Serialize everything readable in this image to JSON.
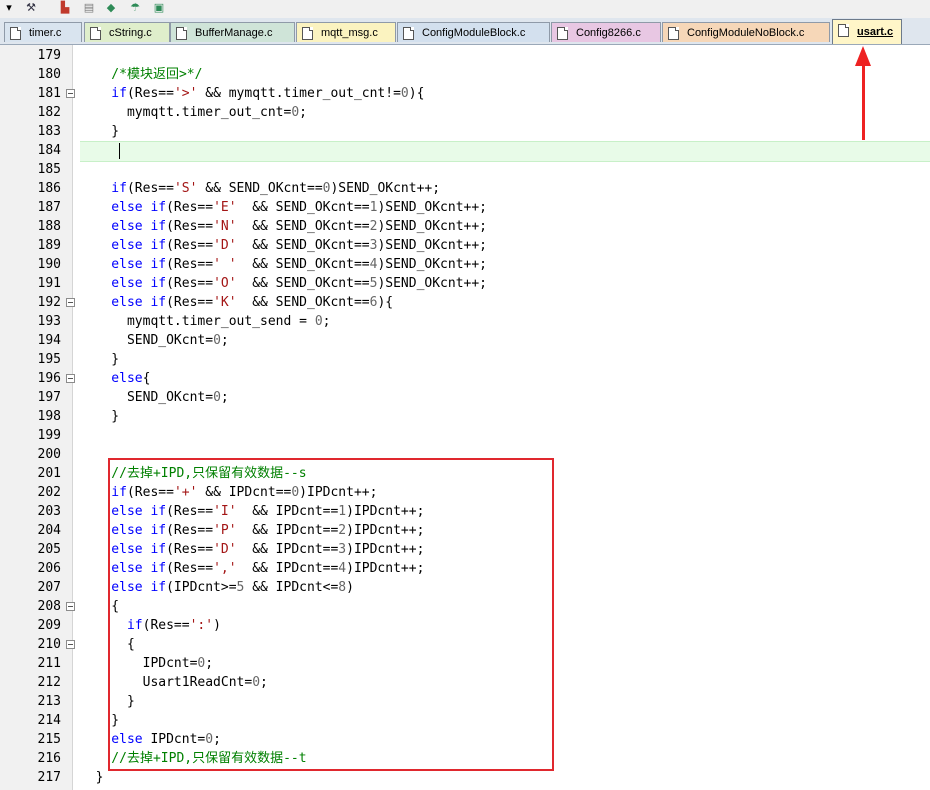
{
  "toolbar": {
    "icons": [
      "dropdown-icon",
      "build-icon",
      "tool1-icon",
      "tool2-icon",
      "tool3-icon",
      "tool4-icon",
      "tool5-icon"
    ]
  },
  "tabs": [
    {
      "label": "timer.c",
      "color": "#d9e4ef"
    },
    {
      "label": "cString.c",
      "color": "#dfeecb"
    },
    {
      "label": "BufferManage.c",
      "color": "#cfe4d8"
    },
    {
      "label": "mqtt_msg.c",
      "color": "#fbf3c0"
    },
    {
      "label": "ConfigModuleBlock.c",
      "color": "#d3e0ee"
    },
    {
      "label": "Config8266.c",
      "color": "#e8c7e3"
    },
    {
      "label": "ConfigModuleNoBlock.c",
      "color": "#f6d7b8"
    },
    {
      "label": "usart.c",
      "color": "#fff6c8"
    }
  ],
  "lines": [
    {
      "n": "179",
      "fold": false,
      "t": []
    },
    {
      "n": "180",
      "fold": false,
      "t": [
        [
          "cm",
          "    /*模块返回>*/"
        ]
      ]
    },
    {
      "n": "181",
      "fold": true,
      "t": [
        [
          "kw",
          "    if"
        ],
        [
          "",
          "(Res=="
        ],
        [
          "str",
          "'>'"
        ],
        [
          "",
          " && mymqtt.timer_out_cnt!="
        ],
        [
          "num",
          "0"
        ],
        [
          "",
          "){"
        ]
      ]
    },
    {
      "n": "182",
      "fold": false,
      "t": [
        [
          "",
          "      mymqtt.timer_out_cnt="
        ],
        [
          "num",
          "0"
        ],
        [
          "",
          ";"
        ]
      ]
    },
    {
      "n": "183",
      "fold": false,
      "t": [
        [
          "",
          "    }"
        ]
      ]
    },
    {
      "n": "184",
      "fold": false,
      "t": []
    },
    {
      "n": "185",
      "fold": false,
      "t": []
    },
    {
      "n": "186",
      "fold": false,
      "t": [
        [
          "kw",
          "    if"
        ],
        [
          "",
          "(Res=="
        ],
        [
          "str",
          "'S'"
        ],
        [
          "",
          " && SEND_OKcnt=="
        ],
        [
          "num",
          "0"
        ],
        [
          "",
          ")SEND_OKcnt++;"
        ]
      ]
    },
    {
      "n": "187",
      "fold": false,
      "t": [
        [
          "kw",
          "    else if"
        ],
        [
          "",
          "(Res=="
        ],
        [
          "str",
          "'E'"
        ],
        [
          "",
          "  && SEND_OKcnt=="
        ],
        [
          "num",
          "1"
        ],
        [
          "",
          ")SEND_OKcnt++;"
        ]
      ]
    },
    {
      "n": "188",
      "fold": false,
      "t": [
        [
          "kw",
          "    else if"
        ],
        [
          "",
          "(Res=="
        ],
        [
          "str",
          "'N'"
        ],
        [
          "",
          "  && SEND_OKcnt=="
        ],
        [
          "num",
          "2"
        ],
        [
          "",
          ")SEND_OKcnt++;"
        ]
      ]
    },
    {
      "n": "189",
      "fold": false,
      "t": [
        [
          "kw",
          "    else if"
        ],
        [
          "",
          "(Res=="
        ],
        [
          "str",
          "'D'"
        ],
        [
          "",
          "  && SEND_OKcnt=="
        ],
        [
          "num",
          "3"
        ],
        [
          "",
          ")SEND_OKcnt++;"
        ]
      ]
    },
    {
      "n": "190",
      "fold": false,
      "t": [
        [
          "kw",
          "    else if"
        ],
        [
          "",
          "(Res=="
        ],
        [
          "str",
          "' '"
        ],
        [
          "",
          "  && SEND_OKcnt=="
        ],
        [
          "num",
          "4"
        ],
        [
          "",
          ")SEND_OKcnt++;"
        ]
      ]
    },
    {
      "n": "191",
      "fold": false,
      "t": [
        [
          "kw",
          "    else if"
        ],
        [
          "",
          "(Res=="
        ],
        [
          "str",
          "'O'"
        ],
        [
          "",
          "  && SEND_OKcnt=="
        ],
        [
          "num",
          "5"
        ],
        [
          "",
          ")SEND_OKcnt++;"
        ]
      ]
    },
    {
      "n": "192",
      "fold": true,
      "t": [
        [
          "kw",
          "    else if"
        ],
        [
          "",
          "(Res=="
        ],
        [
          "str",
          "'K'"
        ],
        [
          "",
          "  && SEND_OKcnt=="
        ],
        [
          "num",
          "6"
        ],
        [
          "",
          "){"
        ]
      ]
    },
    {
      "n": "193",
      "fold": false,
      "t": [
        [
          "",
          "      mymqtt.timer_out_send = "
        ],
        [
          "num",
          "0"
        ],
        [
          "",
          ";"
        ]
      ]
    },
    {
      "n": "194",
      "fold": false,
      "t": [
        [
          "",
          "      SEND_OKcnt="
        ],
        [
          "num",
          "0"
        ],
        [
          "",
          ";"
        ]
      ]
    },
    {
      "n": "195",
      "fold": false,
      "t": [
        [
          "",
          "    }"
        ]
      ]
    },
    {
      "n": "196",
      "fold": true,
      "t": [
        [
          "kw",
          "    else"
        ],
        [
          "",
          "{"
        ]
      ]
    },
    {
      "n": "197",
      "fold": false,
      "t": [
        [
          "",
          "      SEND_OKcnt="
        ],
        [
          "num",
          "0"
        ],
        [
          "",
          ";"
        ]
      ]
    },
    {
      "n": "198",
      "fold": false,
      "t": [
        [
          "",
          "    }"
        ]
      ]
    },
    {
      "n": "199",
      "fold": false,
      "t": []
    },
    {
      "n": "200",
      "fold": false,
      "t": []
    },
    {
      "n": "201",
      "fold": false,
      "t": [
        [
          "cm",
          "    //去掉+IPD,只保留有效数据--s"
        ]
      ]
    },
    {
      "n": "202",
      "fold": false,
      "t": [
        [
          "kw",
          "    if"
        ],
        [
          "",
          "(Res=="
        ],
        [
          "str",
          "'+'"
        ],
        [
          "",
          " && IPDcnt=="
        ],
        [
          "num",
          "0"
        ],
        [
          "",
          ")IPDcnt++;"
        ]
      ]
    },
    {
      "n": "203",
      "fold": false,
      "t": [
        [
          "kw",
          "    else if"
        ],
        [
          "",
          "(Res=="
        ],
        [
          "str",
          "'I'"
        ],
        [
          "",
          "  && IPDcnt=="
        ],
        [
          "num",
          "1"
        ],
        [
          "",
          ")IPDcnt++;"
        ]
      ]
    },
    {
      "n": "204",
      "fold": false,
      "t": [
        [
          "kw",
          "    else if"
        ],
        [
          "",
          "(Res=="
        ],
        [
          "str",
          "'P'"
        ],
        [
          "",
          "  && IPDcnt=="
        ],
        [
          "num",
          "2"
        ],
        [
          "",
          ")IPDcnt++;"
        ]
      ]
    },
    {
      "n": "205",
      "fold": false,
      "t": [
        [
          "kw",
          "    else if"
        ],
        [
          "",
          "(Res=="
        ],
        [
          "str",
          "'D'"
        ],
        [
          "",
          "  && IPDcnt=="
        ],
        [
          "num",
          "3"
        ],
        [
          "",
          ")IPDcnt++;"
        ]
      ]
    },
    {
      "n": "206",
      "fold": false,
      "t": [
        [
          "kw",
          "    else if"
        ],
        [
          "",
          "(Res=="
        ],
        [
          "str",
          "','"
        ],
        [
          "",
          "  && IPDcnt=="
        ],
        [
          "num",
          "4"
        ],
        [
          "",
          ")IPDcnt++;"
        ]
      ]
    },
    {
      "n": "207",
      "fold": false,
      "t": [
        [
          "kw",
          "    else if"
        ],
        [
          "",
          "(IPDcnt>="
        ],
        [
          "num",
          "5"
        ],
        [
          "",
          " && IPDcnt<="
        ],
        [
          "num",
          "8"
        ],
        [
          "",
          ")"
        ]
      ]
    },
    {
      "n": "208",
      "fold": true,
      "t": [
        [
          "",
          "    {"
        ]
      ]
    },
    {
      "n": "209",
      "fold": false,
      "t": [
        [
          "kw",
          "      if"
        ],
        [
          "",
          "(Res=="
        ],
        [
          "str",
          "':'"
        ],
        [
          "",
          ")"
        ]
      ]
    },
    {
      "n": "210",
      "fold": true,
      "t": [
        [
          "",
          "      {"
        ]
      ]
    },
    {
      "n": "211",
      "fold": false,
      "t": [
        [
          "",
          "        IPDcnt="
        ],
        [
          "num",
          "0"
        ],
        [
          "",
          ";"
        ]
      ]
    },
    {
      "n": "212",
      "fold": false,
      "t": [
        [
          "",
          "        Usart1ReadCnt="
        ],
        [
          "num",
          "0"
        ],
        [
          "",
          ";"
        ]
      ]
    },
    {
      "n": "213",
      "fold": false,
      "t": [
        [
          "",
          "      }"
        ]
      ]
    },
    {
      "n": "214",
      "fold": false,
      "t": [
        [
          "",
          "    }"
        ]
      ]
    },
    {
      "n": "215",
      "fold": false,
      "t": [
        [
          "kw",
          "    else"
        ],
        [
          "",
          " IPDcnt="
        ],
        [
          "num",
          "0"
        ],
        [
          "",
          ";"
        ]
      ]
    },
    {
      "n": "216",
      "fold": false,
      "t": [
        [
          "cm",
          "    //去掉+IPD,只保留有效数据--t"
        ]
      ]
    },
    {
      "n": "217",
      "fold": false,
      "t": [
        [
          "",
          "  }"
        ]
      ]
    }
  ]
}
